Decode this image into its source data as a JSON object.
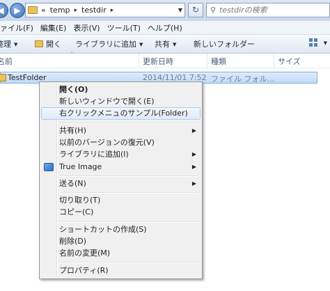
{
  "address_bar": {
    "breadcrumb_prefix": "«",
    "crumbs": [
      "temp",
      "testdir"
    ],
    "crumb_separator": "▸",
    "search_placeholder": "testdirの検索"
  },
  "menubar": {
    "items": [
      "ァイル(F)",
      "編集(E)",
      "表示(V)",
      "ツール(T)",
      "ヘルプ(H)"
    ]
  },
  "commandbar": {
    "organize": "整理",
    "open": "開く",
    "add_to_library": "ライブラリに追加",
    "share": "共有",
    "new_folder": "新しいフォルダー"
  },
  "columns": {
    "name": "名前",
    "modified": "更新日時",
    "type": "種類",
    "size": "サイズ"
  },
  "file_row": {
    "name": "TestFolder",
    "modified": "2014/11/01 7:52",
    "type": "ファイル フォル..."
  },
  "context_menu": {
    "items": [
      {
        "label": "開く(O)",
        "bold": true
      },
      {
        "label": "新しいウィンドウで開く(E)"
      },
      {
        "label": "右クリックメニュのサンプル(Folder)",
        "hover": true
      },
      {
        "label": "共有(H)",
        "submenu": true
      },
      {
        "label": "以前のバージョンの復元(V)"
      },
      {
        "label": "ライブラリに追加(I)",
        "submenu": true
      },
      {
        "label": "True Image",
        "submenu": true,
        "icon": "true-image-icon"
      },
      {
        "label": "送る(N)",
        "submenu": true
      },
      {
        "label": "切り取り(T)"
      },
      {
        "label": "コピー(C)"
      },
      {
        "label": "ショートカットの作成(S)"
      },
      {
        "label": "削除(D)"
      },
      {
        "label": "名前の変更(M)"
      },
      {
        "label": "プロパティ(R)"
      }
    ],
    "submenu_arrow": "▶"
  },
  "colors": {
    "selection_fill": "#c3dcf7",
    "selection_border": "#84acdd",
    "menu_background": "#f0f0f0",
    "toolbar_gradient": "#dfe8f3"
  }
}
